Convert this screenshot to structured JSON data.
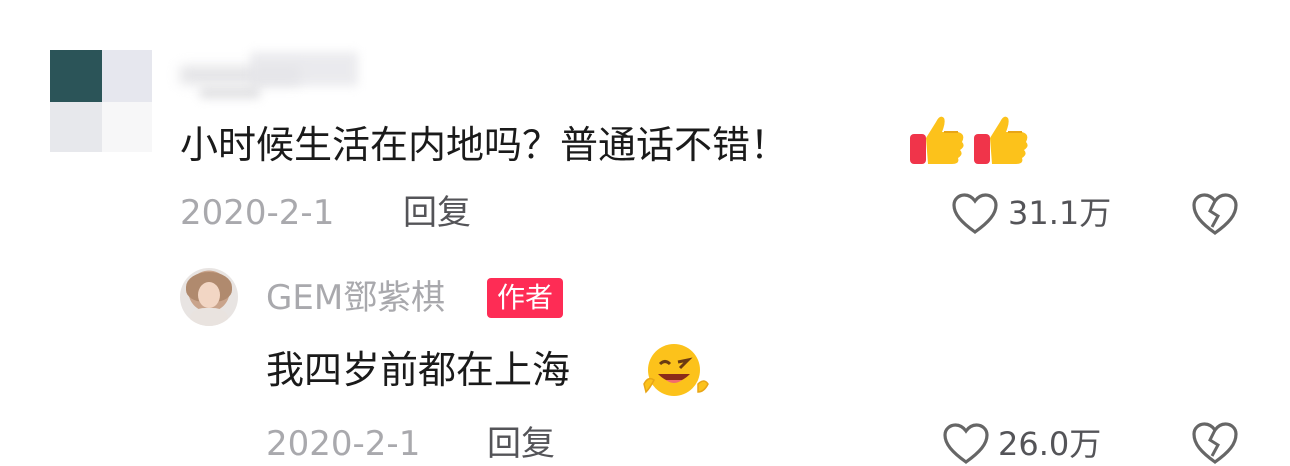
{
  "comment1": {
    "text": "小时候生活在内地吗？普通话不错！",
    "date": "2020-2-1",
    "reply_label": "回复",
    "like_count": "31.1万",
    "emojis": [
      "thumbs-up-icon",
      "thumbs-up-icon"
    ]
  },
  "reply1": {
    "author": "GEM鄧紫棋",
    "badge": "作者",
    "text": "我四岁前都在上海",
    "emoji": "wink-face-icon",
    "date": "2020-2-1",
    "reply_label": "回复",
    "like_count": "26.0万"
  },
  "colors": {
    "badge_bg": "#fe2c55",
    "text_primary": "#1a1a1a",
    "text_secondary": "#a9a9ad",
    "text_action": "#545458"
  }
}
